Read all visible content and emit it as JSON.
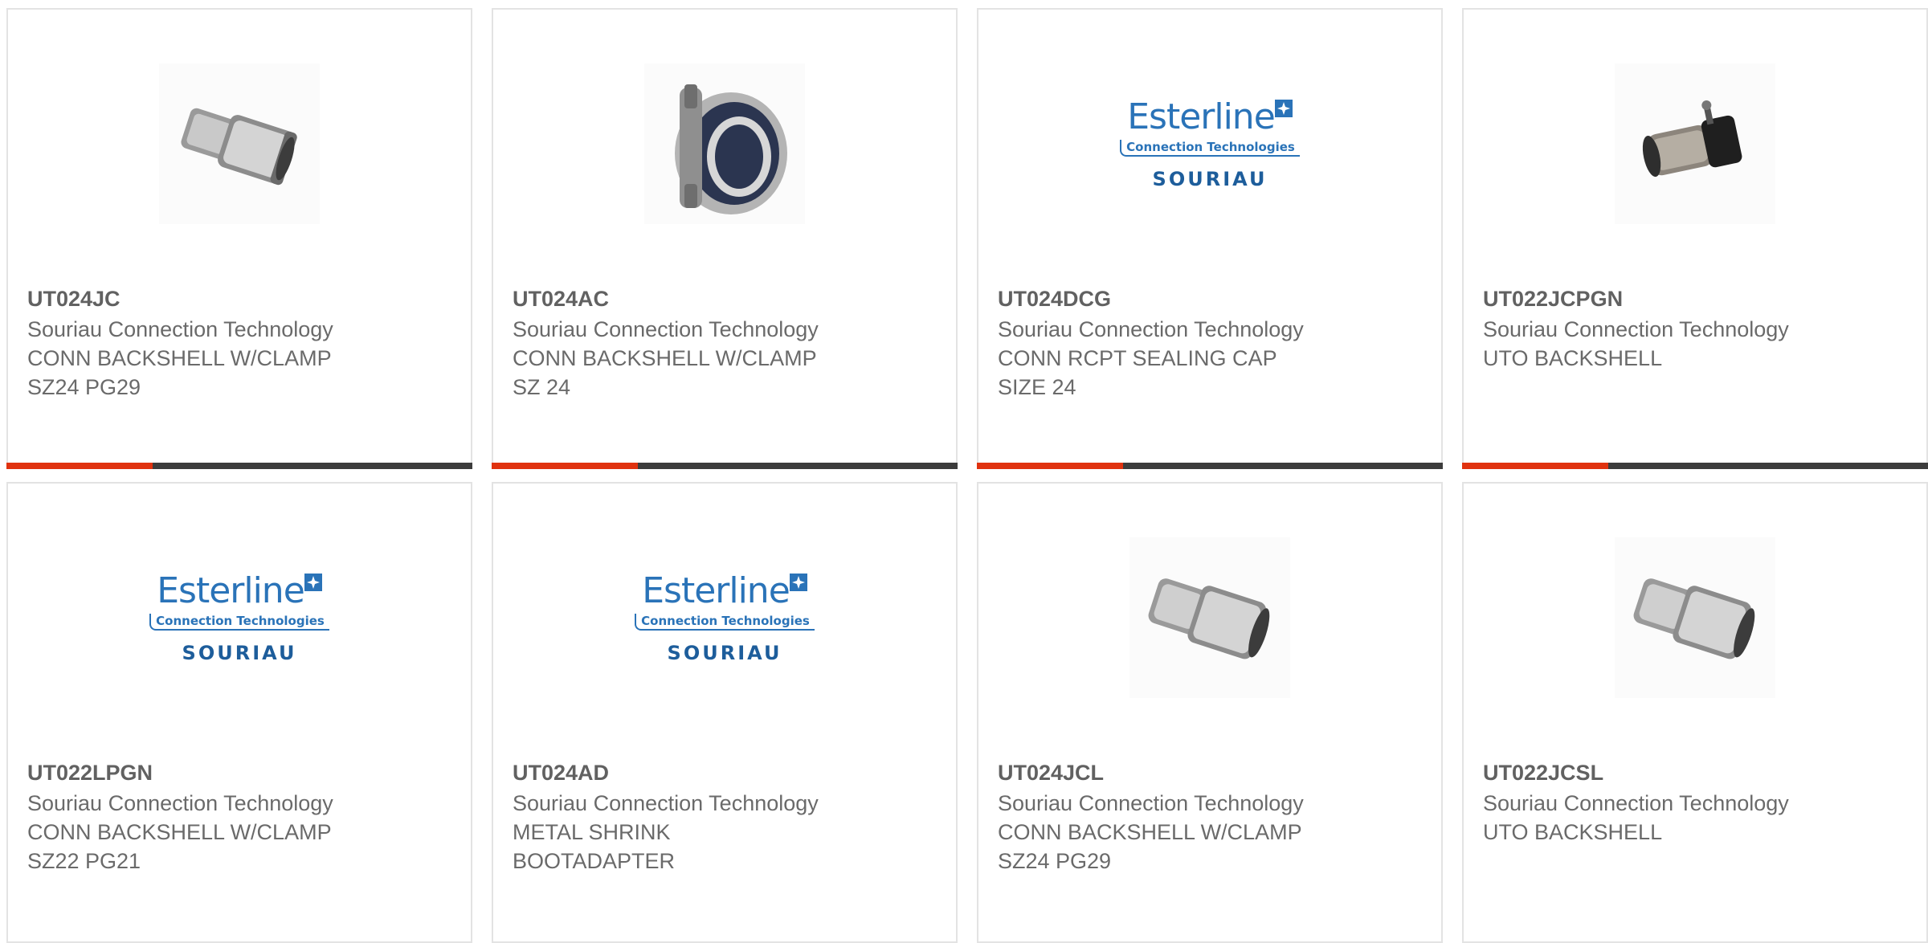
{
  "colors": {
    "accent": "#e0320f",
    "bar": "#3c3c3c",
    "logo_blue": "#2a73b8"
  },
  "products": [
    {
      "part_number": "UT024JC",
      "manufacturer": "Souriau Connection Technology",
      "desc1": "CONN BACKSHELL W/CLAMP",
      "desc2": "SZ24 PG29",
      "image": "backshell-photo"
    },
    {
      "part_number": "UT024AC",
      "manufacturer": "Souriau Connection Technology",
      "desc1": "CONN BACKSHELL W/CLAMP",
      "desc2": "SZ 24",
      "image": "clamp-photo"
    },
    {
      "part_number": "UT024DCG",
      "manufacturer": "Souriau Connection Technology",
      "desc1": "CONN RCPT SEALING CAP",
      "desc2": "SIZE 24",
      "image": "esterline-logo"
    },
    {
      "part_number": "UT022JCPGN",
      "manufacturer": "Souriau Connection Technology",
      "desc1": "UTO BACKSHELL",
      "desc2": "",
      "image": "backshell-black-photo"
    },
    {
      "part_number": "UT022LPGN",
      "manufacturer": "Souriau Connection Technology",
      "desc1": "CONN BACKSHELL W/CLAMP",
      "desc2": "SZ22 PG21",
      "image": "esterline-logo"
    },
    {
      "part_number": "UT024AD",
      "manufacturer": "Souriau Connection Technology",
      "desc1": "METAL SHRINK",
      "desc2": "BOOTADAPTER",
      "image": "esterline-logo"
    },
    {
      "part_number": "UT024JCL",
      "manufacturer": "Souriau Connection Technology",
      "desc1": "CONN BACKSHELL W/CLAMP",
      "desc2": "SZ24 PG29",
      "image": "backshell-photo"
    },
    {
      "part_number": "UT022JCSL",
      "manufacturer": "Souriau Connection Technology",
      "desc1": "UTO BACKSHELL",
      "desc2": "",
      "image": "backshell-photo"
    }
  ],
  "logo": {
    "brand": "Esterline",
    "sub": "Connection Technologies",
    "name": "SOURIAU"
  }
}
